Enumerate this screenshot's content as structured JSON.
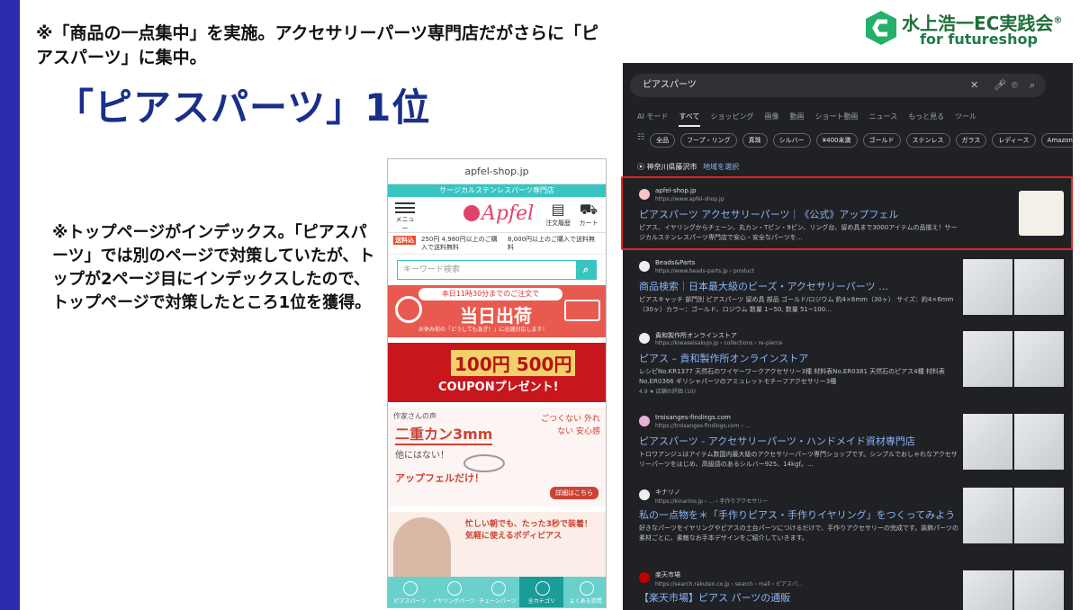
{
  "slide": {
    "note_top": "※「商品の一点集中」を実施。アクセサリーパーツ専門店だがさらに「ピアスパーツ」に集中。",
    "headline": "「ピアスパーツ」1位",
    "side_note": "※トップページがインデックス。「ピアスパーツ」では別のページで対策していたが、トップが2ページ目にインデックスしたので、トップページで対策したところ1位を獲得。",
    "logo_line1": "水上浩一EC実践会",
    "logo_reg": "®",
    "logo_line2": "for futureshop",
    "accent_color": "#2b2bb0"
  },
  "phone": {
    "url": "apfel-shop.jp",
    "tagline": "サージカルステンレスパーツ専門店",
    "menu_label": "メニュー",
    "logo_text": "Apfel",
    "history_label": "注文履歴",
    "cart_label": "カート",
    "shipping_left_badge": "送料込",
    "shipping_left": "250円 4,980円以上のご購入で送料無料",
    "shipping_right": "8,000円以上のご購入で送料無料",
    "search_placeholder": "キーワード検索",
    "banner1_pill": "本日11時30分までのご注文で",
    "banner1_big": "当日出荷",
    "banner1_sub": "お休み前の「どうしても急ぎ！」に迅速対応します！",
    "banner2_values": "100円 500円",
    "banner2_coupon": "COUPONプレゼント!",
    "banner3_top": "作家さんの声",
    "banner3_title": "二重カン3mm",
    "banner3_mid": "他にはない！",
    "banner3_brand": "アップフェルだけ！",
    "banner3_right": "ごつくない 外れない 安心感",
    "banner3_button": "詳細はこちら",
    "banner4_text": "忙しい朝でも、たった3秒で装着！ 気軽に使えるボディピアス",
    "tabs": [
      "ピアスパーツ",
      "イヤリングパーツ",
      "チェーンパーツ",
      "全カテゴリ",
      "よくある質問"
    ]
  },
  "serp": {
    "query": "ピアスパーツ",
    "tabs": [
      "AI モード",
      "すべて",
      "ショッピング",
      "画像",
      "動画",
      "ショート動画",
      "ニュース",
      "もっと見る",
      "ツール"
    ],
    "chips": [
      "全品",
      "フープ・リング",
      "真珠",
      "シルバー",
      "¥400未満",
      "ゴールド",
      "ステンレス",
      "ガラス",
      "レディース",
      "Amazon"
    ],
    "location": "神奈川県藤沢市",
    "location_link": "地域を選択",
    "results": [
      {
        "site": "apfel-shop.jp",
        "url": "https://www.apfel-shop.jp",
        "title": "ピアスパーツ アクセサリーパーツ｜《公式》アップフェル",
        "snippet": "ピアス、イヤリングからチェーン、丸カン・Tピン・9ピン、リング台、留め具まで3000アイテムの品揃え！サージカルステンレスパーツ専門店で安心・安全なパーツを…"
      },
      {
        "site": "Beads&Parts",
        "url": "https://www.beads-parts.jp › product",
        "title": "商品検索｜日本最大級のビーズ・アクセサリーパーツ …",
        "snippet": "ピアスキャッチ 部門別 ピアスパーツ 留め具 部品 ゴールド/ロジウム 約4×6mm（30ヶ） サイズ：約4×6mm（30ヶ）カラー：ゴールド、ロジウム 数量 1~50, 数量 51~100…"
      },
      {
        "site": "貴和製作所オンラインストア",
        "url": "https://kiwaseisakujo.jp › collections › re-pierce",
        "title": "ピアス – 貴和製作所オンラインストア",
        "snippet": "レシピNo.KR1377 天然石のワイヤーワークアクセサリー3種 材料表No.ER0381 天然石のピアス4種 材料表No.ER0366 ギリシャパーツのアミュレットモチーフアクセサリー3種",
        "rating": "4.9 ★ 店舗の評価 (10)"
      },
      {
        "site": "troisanges-findings.com",
        "url": "https://troisanges-findings.com › …",
        "title": "ピアスパーツ - アクセサリーパーツ・ハンドメイド資材専門店",
        "snippet": "トロワアンジュはアイテム数国内最大級のアクセサリーパーツ専門ショップです。シンプルでおしゃれなアクセサリーパーツをはじめ、高級感のあるシルバー925、14kgf。…"
      },
      {
        "site": "キナリノ",
        "url": "https://kinarino.jp › … › 手作りアクセサリー",
        "title": "私の一点物を＊「手作りピアス・手作りイヤリング」をつくってみよう",
        "snippet": "好きなパーツをイヤリングやピアスの土台パーツにつけるだけで、手作りアクセサリーの完成です。装飾パーツの素材ごとに、素敵なお手本デザインをご紹介していきます。"
      },
      {
        "site": "楽天市場",
        "url": "https://search.rakuten.co.jp › search › mall › ピアスパ…",
        "title": "【楽天市場】ピアス パーツの通販",
        "snippet": ""
      }
    ]
  }
}
